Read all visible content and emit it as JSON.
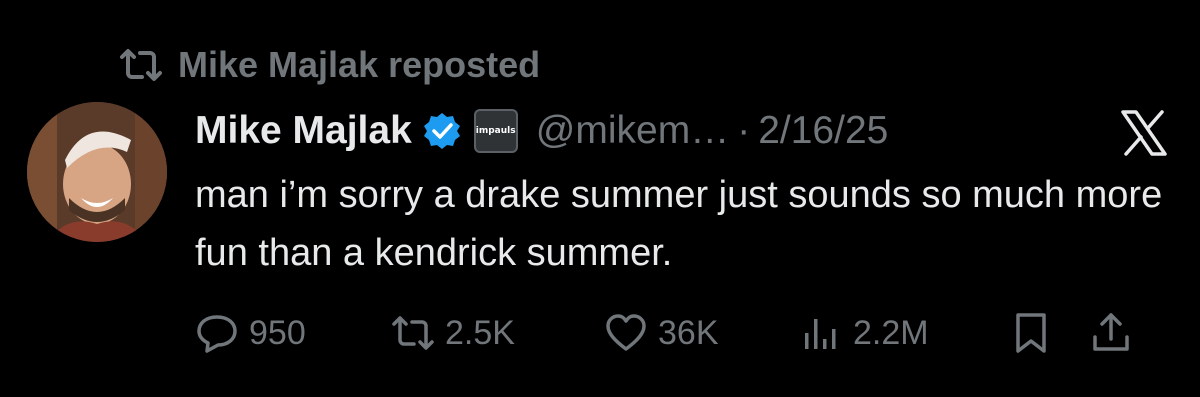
{
  "repost_line": {
    "label": "Mike Majlak reposted"
  },
  "tweet": {
    "display_name": "Mike Majlak",
    "handle": "@mikem…",
    "separator": "·",
    "date": "2/16/25",
    "affiliate_badge_text": "impaulsive",
    "text": "man i’m sorry a drake summer just sounds so much more fun than a kendrick summer."
  },
  "metrics": {
    "replies": "950",
    "reposts": "2.5K",
    "likes": "36K",
    "views": "2.2M"
  },
  "colors": {
    "background": "#000000",
    "primary_text": "#e7e9ea",
    "secondary_text": "#71767b",
    "verified_blue": "#1d9bf0"
  },
  "icons": [
    "repost-icon",
    "verified-badge-icon",
    "x-logo-icon",
    "reply-icon",
    "like-icon",
    "views-icon",
    "bookmark-icon",
    "share-icon"
  ]
}
